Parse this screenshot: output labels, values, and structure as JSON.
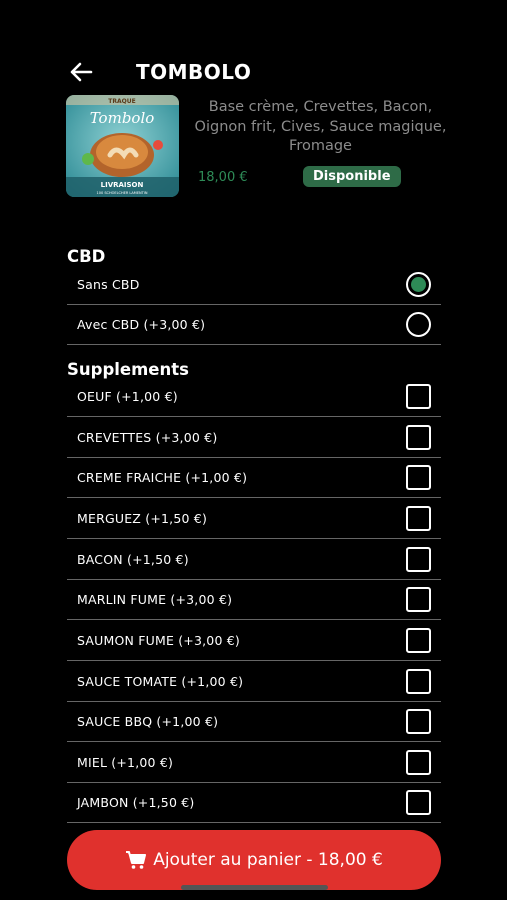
{
  "header": {
    "title": "TOMBOLO",
    "back_icon": "arrow-left-icon"
  },
  "product": {
    "description": "Base  crème, Crevettes, Bacon, Oignon frit, Cives, Sauce magique, Fromage",
    "price": "18,00 €",
    "availability": "Disponible",
    "image_text_brand": "TRAQUE",
    "image_text_name": "Tombolo",
    "image_text_delivery": "LIVRAISON",
    "image_text_sub": "100 SCHOELCHER LAMENTIN"
  },
  "cbd": {
    "title": "CBD",
    "options": [
      {
        "label": "Sans CBD",
        "selected": true
      },
      {
        "label": "Avec CBD  (+3,00 €)",
        "selected": false
      }
    ]
  },
  "supplements": {
    "title": "Supplements",
    "items": [
      {
        "label": "OEUF  (+1,00 €)"
      },
      {
        "label": "CREVETTES  (+3,00 €)"
      },
      {
        "label": "CREME FRAICHE  (+1,00 €)"
      },
      {
        "label": " MERGUEZ  (+1,50 €)"
      },
      {
        "label": "BACON  (+1,50 €)"
      },
      {
        "label": "MARLIN FUME  (+3,00 €)"
      },
      {
        "label": "SAUMON FUME  (+3,00 €)"
      },
      {
        "label": "SAUCE TOMATE  (+1,00 €)"
      },
      {
        "label": "SAUCE BBQ  (+1,00 €)"
      },
      {
        "label": "MIEL  (+1,00 €)"
      },
      {
        "label": " JAMBON  (+1,50 €)"
      }
    ]
  },
  "cart_button": {
    "label": "Ajouter au panier - 18,00 €",
    "icon": "cart-icon"
  },
  "colors": {
    "accent_green": "#2e8b57",
    "badge_green": "#2e6b47",
    "cta_red": "#e0312d"
  }
}
